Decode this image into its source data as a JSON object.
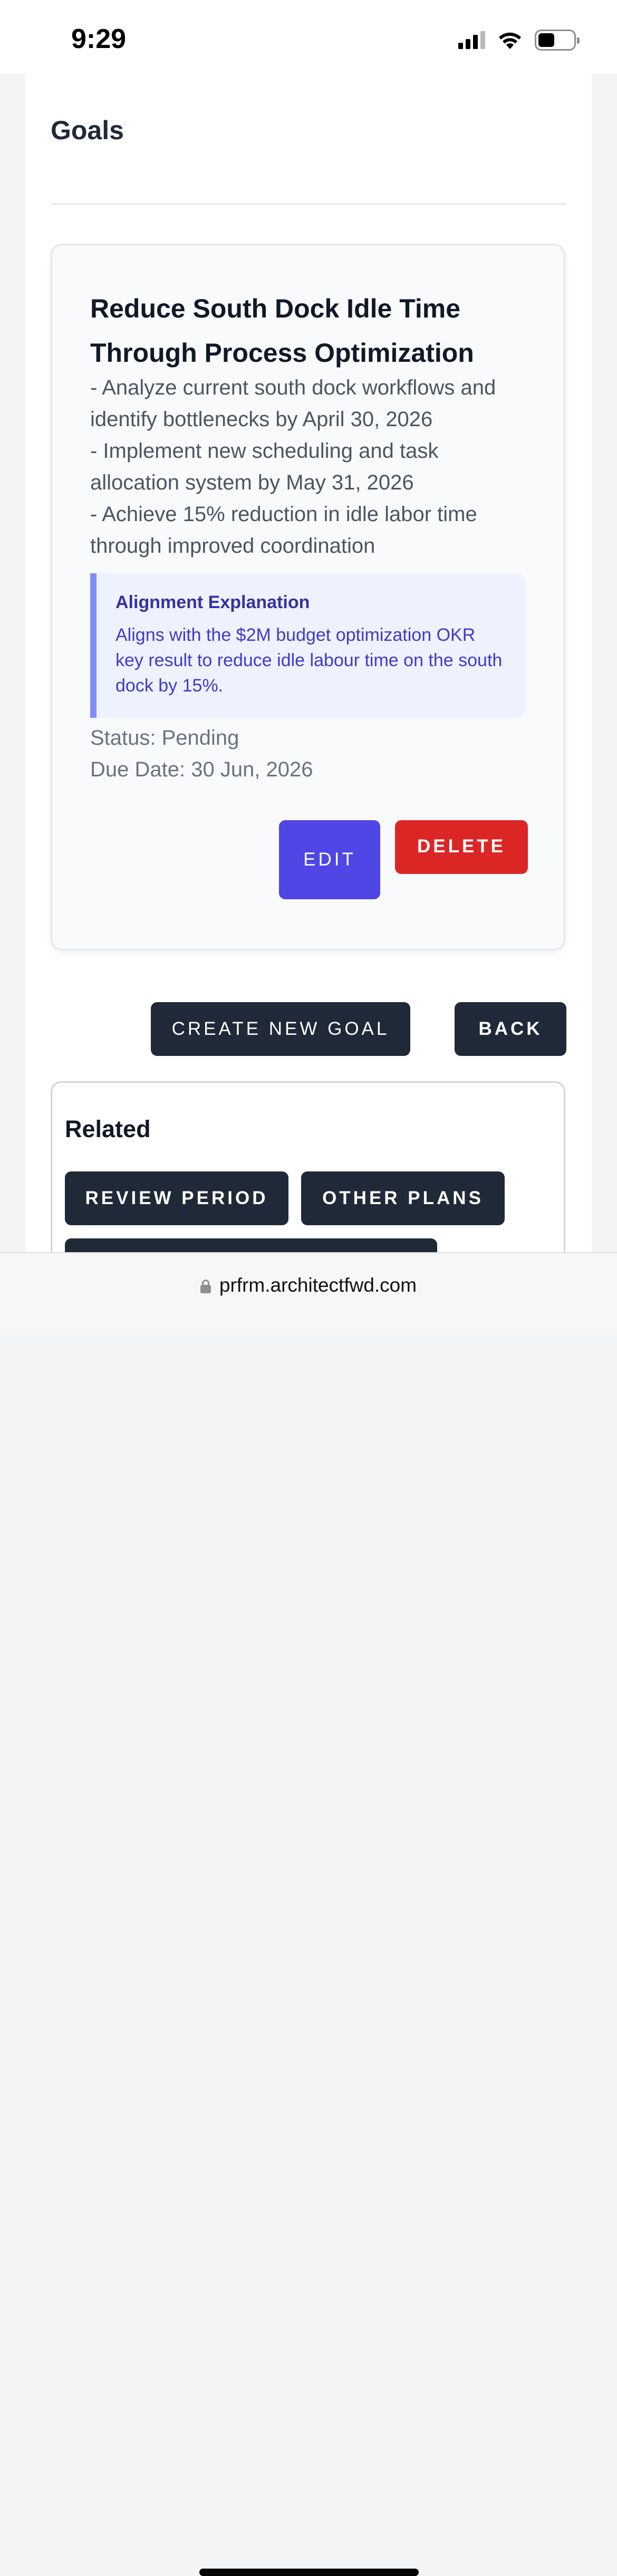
{
  "status_bar": {
    "time": "9:29",
    "icons": [
      "signal-icon",
      "wifi-icon",
      "battery-icon"
    ]
  },
  "page": {
    "title": "Goals"
  },
  "goal": {
    "title": "Reduce South Dock Idle Time Through Process Optimization",
    "description": "- Analyze current south dock workflows and identify bottlenecks by April 30, 2026\n- Implement new scheduling and task allocation system by May 31, 2026\n- Achieve 15% reduction in idle labor time through improved coordination",
    "alignment": {
      "title": "Alignment Explanation",
      "text": "Aligns with the $2M budget optimization OKR key result to reduce idle labour time on the south dock by 15%."
    },
    "status": "Status: Pending",
    "due_date": "Due Date: 30 Jun, 2026",
    "edit_label": "EDIT",
    "delete_label": "DELETE"
  },
  "actions": {
    "create_label": "CREATE NEW GOAL",
    "back_label": "BACK"
  },
  "related": {
    "title": "Related",
    "buttons": [
      "REVIEW PERIOD",
      "OTHER PLANS",
      ""
    ]
  },
  "browser": {
    "url": "prfrm.architectfwd.com"
  },
  "colors": {
    "primary": "#4f46e5",
    "danger": "#dc2626",
    "dark": "#1f2937",
    "alignment_bg": "#eef2ff",
    "alignment_accent": "#818cf8"
  }
}
